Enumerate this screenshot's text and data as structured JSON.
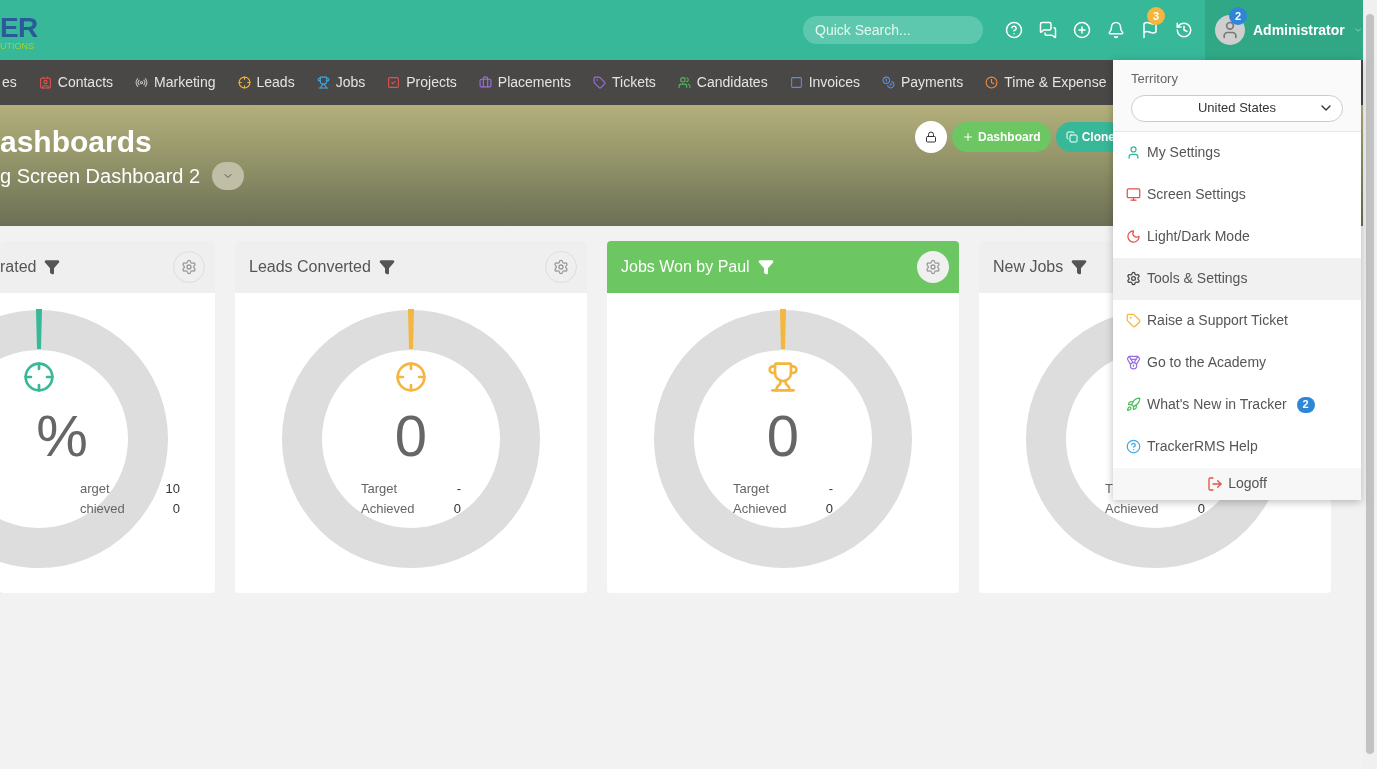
{
  "logo": {
    "word": "ER",
    "tagline": "UTIONS"
  },
  "search": {
    "placeholder": "Quick Search..."
  },
  "toolbar": [
    {
      "kind": "help"
    },
    {
      "kind": "chat"
    },
    {
      "kind": "add"
    },
    {
      "kind": "bell"
    },
    {
      "kind": "flag",
      "badge": "3"
    },
    {
      "kind": "history"
    }
  ],
  "user": {
    "name": "Administrator",
    "badge": "2"
  },
  "nav": [
    {
      "label": "es",
      "kind": "none"
    },
    {
      "label": "Contacts",
      "kind": "contact"
    },
    {
      "label": "Marketing",
      "kind": "signal"
    },
    {
      "label": "Leads",
      "kind": "target"
    },
    {
      "label": "Jobs",
      "kind": "trophy"
    },
    {
      "label": "Projects",
      "kind": "check"
    },
    {
      "label": "Placements",
      "kind": "briefcase"
    },
    {
      "label": "Tickets",
      "kind": "tag"
    },
    {
      "label": "Candidates",
      "kind": "users"
    },
    {
      "label": "Invoices",
      "kind": "square"
    },
    {
      "label": "Payments",
      "kind": "coins"
    },
    {
      "label": "Time & Expense",
      "kind": "clock"
    }
  ],
  "banner": {
    "title": "ashboards",
    "subtitle": "g Screen Dashboard 2",
    "buttons": [
      {
        "kind": "lock"
      },
      {
        "kind": "add",
        "label": "Dashboard"
      },
      {
        "kind": "clone",
        "label": "Clone"
      }
    ]
  },
  "cards": [
    {
      "title": "rated",
      "highlighted": false,
      "color": "#37b898",
      "kind": "target",
      "value": "%",
      "stats": [
        {
          "label": "arget",
          "value": "10"
        },
        {
          "label": "chieved",
          "value": "0"
        }
      ]
    },
    {
      "title": "Leads Converted",
      "highlighted": false,
      "color": "#f4b63f",
      "kind": "target",
      "value": "0",
      "stats": [
        {
          "label": "Target",
          "value": "-"
        },
        {
          "label": "Achieved",
          "value": "0"
        }
      ]
    },
    {
      "title": "Jobs Won by Paul",
      "highlighted": true,
      "color": "#f4b63f",
      "kind": "trophy",
      "value": "0",
      "stats": [
        {
          "label": "Target",
          "value": "-"
        },
        {
          "label": "Achieved",
          "value": "0"
        }
      ]
    },
    {
      "title": "New Jobs",
      "highlighted": false,
      "stats": [
        {
          "label": "T"
        },
        {
          "label": "Achieved",
          "value": "0"
        }
      ]
    }
  ],
  "menu": {
    "territory_label": "Territory",
    "territory": "United States",
    "items": [
      {
        "label": "My Settings",
        "kind": "user",
        "selected": false
      },
      {
        "label": "Screen Settings",
        "kind": "screen",
        "selected": false
      },
      {
        "label": "Light/Dark Mode",
        "kind": "moon",
        "selected": false
      },
      {
        "label": "Tools & Settings",
        "kind": "gear",
        "selected": true
      },
      {
        "label": "Raise a Support Ticket",
        "kind": "tag",
        "selected": false
      },
      {
        "label": "Go to the Academy",
        "kind": "medal",
        "selected": false
      },
      {
        "label": "What's New in Tracker",
        "kind": "rocket",
        "selected": false,
        "badge": "2"
      },
      {
        "label": "TrackerRMS Help",
        "kind": "help",
        "selected": false
      }
    ],
    "logoff": "Logoff"
  }
}
